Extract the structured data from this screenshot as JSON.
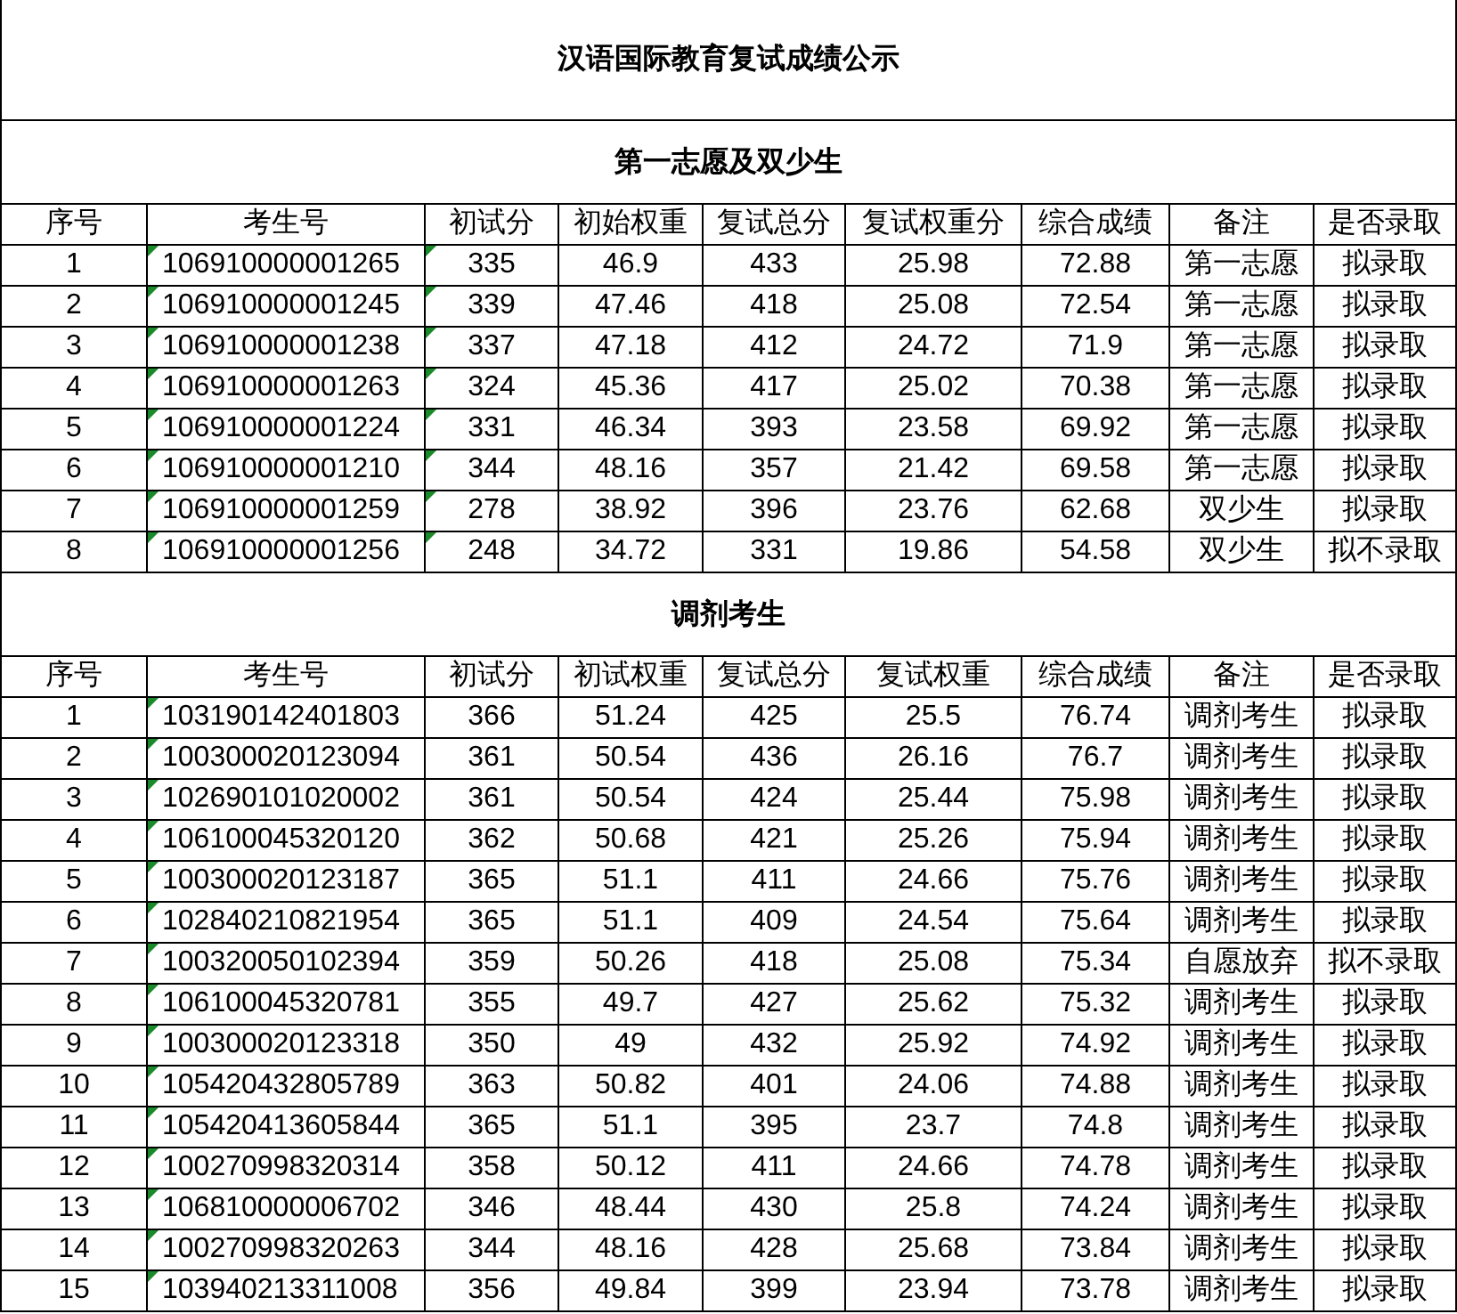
{
  "title": "汉语国际教育复试成绩公示",
  "sections": [
    {
      "title": "第一志愿及双少生",
      "columns": [
        "序号",
        "考生号",
        "初试分",
        "初始权重",
        "复试总分",
        "复试权重分",
        "综合成绩",
        "备注",
        "是否录取"
      ],
      "flags": {
        "id": true,
        "score": true
      },
      "rows": [
        [
          "1",
          "106910000001265",
          "335",
          "46.9",
          "433",
          "25.98",
          "72.88",
          "第一志愿",
          "拟录取"
        ],
        [
          "2",
          "106910000001245",
          "339",
          "47.46",
          "418",
          "25.08",
          "72.54",
          "第一志愿",
          "拟录取"
        ],
        [
          "3",
          "106910000001238",
          "337",
          "47.18",
          "412",
          "24.72",
          "71.9",
          "第一志愿",
          "拟录取"
        ],
        [
          "4",
          "106910000001263",
          "324",
          "45.36",
          "417",
          "25.02",
          "70.38",
          "第一志愿",
          "拟录取"
        ],
        [
          "5",
          "106910000001224",
          "331",
          "46.34",
          "393",
          "23.58",
          "69.92",
          "第一志愿",
          "拟录取"
        ],
        [
          "6",
          "106910000001210",
          "344",
          "48.16",
          "357",
          "21.42",
          "69.58",
          "第一志愿",
          "拟录取"
        ],
        [
          "7",
          "106910000001259",
          "278",
          "38.92",
          "396",
          "23.76",
          "62.68",
          "双少生",
          "拟录取"
        ],
        [
          "8",
          "106910000001256",
          "248",
          "34.72",
          "331",
          "19.86",
          "54.58",
          "双少生",
          "拟不录取"
        ]
      ]
    },
    {
      "title": "调剂考生",
      "columns": [
        "序号",
        "考生号",
        "初试分",
        "初试权重",
        "复试总分",
        "复试权重",
        "综合成绩",
        "备注",
        "是否录取"
      ],
      "flags": {
        "id": true,
        "score": false
      },
      "rows": [
        [
          "1",
          "103190142401803",
          "366",
          "51.24",
          "425",
          "25.5",
          "76.74",
          "调剂考生",
          "拟录取"
        ],
        [
          "2",
          "100300020123094",
          "361",
          "50.54",
          "436",
          "26.16",
          "76.7",
          "调剂考生",
          "拟录取"
        ],
        [
          "3",
          "102690101020002",
          "361",
          "50.54",
          "424",
          "25.44",
          "75.98",
          "调剂考生",
          "拟录取"
        ],
        [
          "4",
          "106100045320120",
          "362",
          "50.68",
          "421",
          "25.26",
          "75.94",
          "调剂考生",
          "拟录取"
        ],
        [
          "5",
          "100300020123187",
          "365",
          "51.1",
          "411",
          "24.66",
          "75.76",
          "调剂考生",
          "拟录取"
        ],
        [
          "6",
          "102840210821954",
          "365",
          "51.1",
          "409",
          "24.54",
          "75.64",
          "调剂考生",
          "拟录取"
        ],
        [
          "7",
          "100320050102394",
          "359",
          "50.26",
          "418",
          "25.08",
          "75.34",
          "自愿放弃",
          "拟不录取"
        ],
        [
          "8",
          "106100045320781",
          "355",
          "49.7",
          "427",
          "25.62",
          "75.32",
          "调剂考生",
          "拟录取"
        ],
        [
          "9",
          "100300020123318",
          "350",
          "49",
          "432",
          "25.92",
          "74.92",
          "调剂考生",
          "拟录取"
        ],
        [
          "10",
          "105420432805789",
          "363",
          "50.82",
          "401",
          "24.06",
          "74.88",
          "调剂考生",
          "拟录取"
        ],
        [
          "11",
          "105420413605844",
          "365",
          "51.1",
          "395",
          "23.7",
          "74.8",
          "调剂考生",
          "拟录取"
        ],
        [
          "12",
          "100270998320314",
          "358",
          "50.12",
          "411",
          "24.66",
          "74.78",
          "调剂考生",
          "拟录取"
        ],
        [
          "13",
          "106810000006702",
          "346",
          "48.44",
          "430",
          "25.8",
          "74.24",
          "调剂考生",
          "拟录取"
        ],
        [
          "14",
          "100270998320263",
          "344",
          "48.16",
          "428",
          "25.68",
          "73.84",
          "调剂考生",
          "拟录取"
        ],
        [
          "15",
          "103940213311008",
          "356",
          "49.84",
          "399",
          "23.94",
          "73.78",
          "调剂考生",
          "拟录取"
        ]
      ]
    }
  ]
}
